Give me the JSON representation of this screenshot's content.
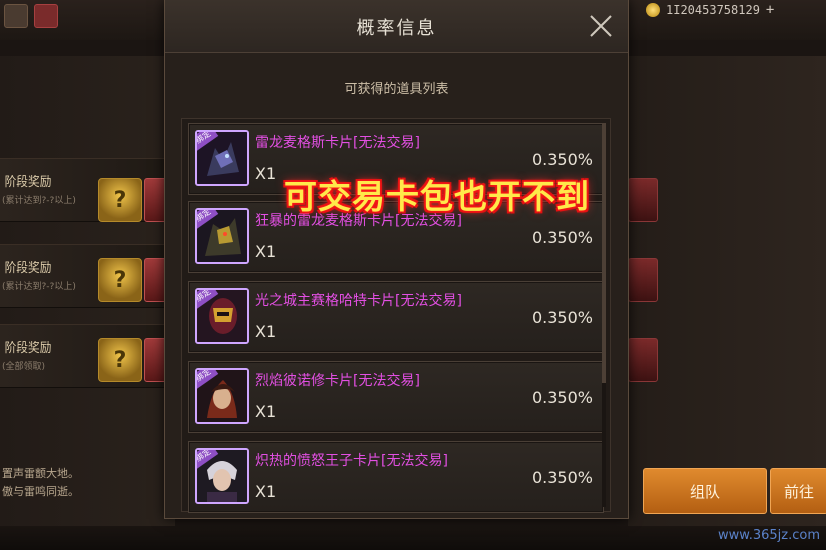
{
  "top_bar": {
    "currency_amount": "1I20453758129",
    "plus_label": "+"
  },
  "background": {
    "rows": [
      {
        "title": "阶段奖励",
        "sub": "(累计达到?-?以上)"
      },
      {
        "title": "阶段奖励",
        "sub": "(累计达到?-?以上)"
      },
      {
        "title": "阶段奖励",
        "sub": "(全部领取)"
      }
    ],
    "box_symbol": "?",
    "bottom_text": [
      "置声雷颤大地。",
      "傲与雷鸣同逝。"
    ],
    "buttons": {
      "team": "组队",
      "go": "前往"
    },
    "watermark": "www.365jz.com"
  },
  "dialog": {
    "title": "概率信息",
    "section_label": "可获得的道具列表",
    "items": [
      {
        "name": "雷龙麦格斯卡片[无法交易]",
        "quantity": "X1",
        "rate": "0.350%",
        "badge": "绑定"
      },
      {
        "name": "狂暴的雷龙麦格斯卡片[无法交易]",
        "quantity": "X1",
        "rate": "0.350%",
        "badge": "绑定"
      },
      {
        "name": "光之城主赛格哈特卡片[无法交易]",
        "quantity": "X1",
        "rate": "0.350%",
        "badge": "绑定"
      },
      {
        "name": "烈焰彼诺修卡片[无法交易]",
        "quantity": "X1",
        "rate": "0.350%",
        "badge": "绑定"
      },
      {
        "name": "炽热的愤怒王子卡片[无法交易]",
        "quantity": "X1",
        "rate": "0.350%",
        "badge": "绑定"
      }
    ]
  },
  "overlay_caption": "可交易卡包也开不到",
  "colors": {
    "item_name": "#e24fe2",
    "caption_fill": "#ffe94a",
    "caption_outline": "#e01010",
    "button_orange": "#d27a22"
  }
}
